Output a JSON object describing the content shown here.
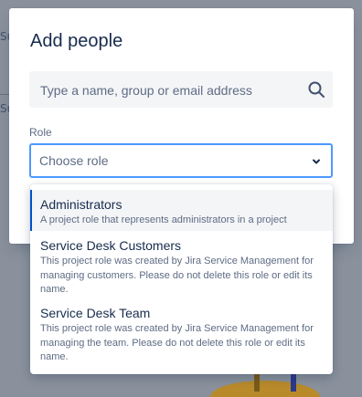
{
  "background": {
    "partial_text_1": "Su",
    "partial_text_2": "Su"
  },
  "modal": {
    "title": "Add people",
    "search": {
      "placeholder": "Type a name, group or email address",
      "icon": "search-icon"
    },
    "role": {
      "label": "Role",
      "value": "Choose role",
      "icon": "chevron-down-icon",
      "options": [
        {
          "title": "Administrators",
          "description": "A project role that represents administrators in a project"
        },
        {
          "title": "Service Desk Customers",
          "description": "This project role was created by Jira Service Management for managing customers. Please do not delete this role or edit its name."
        },
        {
          "title": "Service Desk Team",
          "description": "This project role was created by Jira Service Management for managing the team. Please do not delete this role or edit its name."
        }
      ]
    }
  },
  "colors": {
    "accent": "#0052cc",
    "focus": "#4c9aff",
    "text": "#172b4d",
    "subtle_text": "#5e6c84"
  }
}
